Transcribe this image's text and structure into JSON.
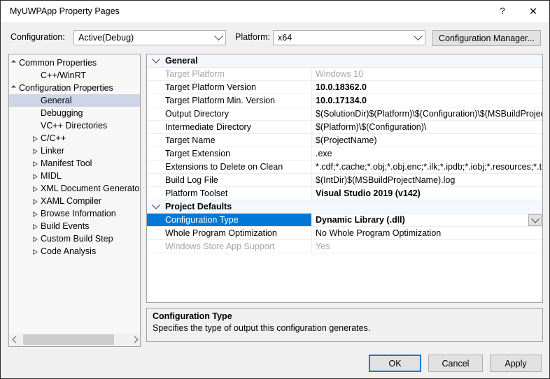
{
  "window": {
    "title": "MyUWPApp Property Pages",
    "help_icon": "help-icon",
    "help_glyph": "?",
    "close_icon": "close-icon",
    "close_glyph": "✕"
  },
  "configbar": {
    "configuration_label": "Configuration:",
    "configuration_value": "Active(Debug)",
    "platform_label": "Platform:",
    "platform_value": "x64",
    "configuration_manager_label": "Configuration Manager..."
  },
  "tree": {
    "selected": "General",
    "items": [
      {
        "label": "Common Properties",
        "indent": 14,
        "twisty": "expanded",
        "selected": false
      },
      {
        "label": "C++/WinRT",
        "indent": 45,
        "twisty": "none",
        "selected": false
      },
      {
        "label": "Configuration Properties",
        "indent": 14,
        "twisty": "expanded",
        "selected": false
      },
      {
        "label": "General",
        "indent": 45,
        "twisty": "none",
        "selected": true
      },
      {
        "label": "Debugging",
        "indent": 45,
        "twisty": "none",
        "selected": false
      },
      {
        "label": "VC++ Directories",
        "indent": 45,
        "twisty": "none",
        "selected": false
      },
      {
        "label": "C/C++",
        "indent": 45,
        "twisty": "collapsed",
        "selected": false
      },
      {
        "label": "Linker",
        "indent": 45,
        "twisty": "collapsed",
        "selected": false
      },
      {
        "label": "Manifest Tool",
        "indent": 45,
        "twisty": "collapsed",
        "selected": false
      },
      {
        "label": "MIDL",
        "indent": 45,
        "twisty": "collapsed",
        "selected": false
      },
      {
        "label": "XML Document Generator",
        "indent": 45,
        "twisty": "collapsed",
        "selected": false
      },
      {
        "label": "XAML Compiler",
        "indent": 45,
        "twisty": "collapsed",
        "selected": false
      },
      {
        "label": "Browse Information",
        "indent": 45,
        "twisty": "collapsed",
        "selected": false
      },
      {
        "label": "Build Events",
        "indent": 45,
        "twisty": "collapsed",
        "selected": false
      },
      {
        "label": "Custom Build Step",
        "indent": 45,
        "twisty": "collapsed",
        "selected": false
      },
      {
        "label": "Code Analysis",
        "indent": 45,
        "twisty": "collapsed",
        "selected": false
      }
    ],
    "hscroll": {
      "left_icon": "chevron-left-icon",
      "right_icon": "chevron-right-icon"
    }
  },
  "grid": {
    "rows": [
      {
        "kind": "category",
        "label": "General",
        "twisty": "expanded"
      },
      {
        "kind": "property",
        "name": "Target Platform",
        "value": "Windows 10",
        "disabled": true,
        "bold": false,
        "selected": false,
        "dropdown": false
      },
      {
        "kind": "property",
        "name": "Target Platform Version",
        "value": "10.0.18362.0",
        "disabled": false,
        "bold": true,
        "selected": false,
        "dropdown": false
      },
      {
        "kind": "property",
        "name": "Target Platform Min. Version",
        "value": "10.0.17134.0",
        "disabled": false,
        "bold": true,
        "selected": false,
        "dropdown": false
      },
      {
        "kind": "property",
        "name": "Output Directory",
        "value": "$(SolutionDir)$(Platform)\\$(Configuration)\\$(MSBuildProjectName)\\",
        "disabled": false,
        "bold": false,
        "selected": false,
        "dropdown": false
      },
      {
        "kind": "property",
        "name": "Intermediate Directory",
        "value": "$(Platform)\\$(Configuration)\\",
        "disabled": false,
        "bold": false,
        "selected": false,
        "dropdown": false
      },
      {
        "kind": "property",
        "name": "Target Name",
        "value": "$(ProjectName)",
        "disabled": false,
        "bold": false,
        "selected": false,
        "dropdown": false
      },
      {
        "kind": "property",
        "name": "Target Extension",
        "value": ".exe",
        "disabled": false,
        "bold": false,
        "selected": false,
        "dropdown": false
      },
      {
        "kind": "property",
        "name": "Extensions to Delete on Clean",
        "value": "*.cdf;*.cache;*.obj;*.obj.enc;*.ilk;*.ipdb;*.iobj;*.resources;*.tlb;*.tli;*.tlh;*.tmp",
        "disabled": false,
        "bold": false,
        "selected": false,
        "dropdown": false
      },
      {
        "kind": "property",
        "name": "Build Log File",
        "value": "$(IntDir)$(MSBuildProjectName).log",
        "disabled": false,
        "bold": false,
        "selected": false,
        "dropdown": false
      },
      {
        "kind": "property",
        "name": "Platform Toolset",
        "value": "Visual Studio 2019 (v142)",
        "disabled": false,
        "bold": true,
        "selected": false,
        "dropdown": false
      },
      {
        "kind": "category",
        "label": "Project Defaults",
        "twisty": "expanded"
      },
      {
        "kind": "property",
        "name": "Configuration Type",
        "value": "Dynamic Library (.dll)",
        "disabled": false,
        "bold": true,
        "selected": true,
        "dropdown": true
      },
      {
        "kind": "property",
        "name": "Whole Program Optimization",
        "value": "No Whole Program Optimization",
        "disabled": false,
        "bold": false,
        "selected": false,
        "dropdown": false
      },
      {
        "kind": "property",
        "name": "Windows Store App Support",
        "value": "Yes",
        "disabled": true,
        "bold": false,
        "selected": false,
        "dropdown": false
      }
    ]
  },
  "description": {
    "title": "Configuration Type",
    "body": "Specifies the type of output this configuration generates."
  },
  "footer": {
    "ok_label": "OK",
    "cancel_label": "Cancel",
    "apply_label": "Apply"
  },
  "colors": {
    "selection_blue": "#0078d7",
    "tree_selection": "#cdd5e6",
    "dialog_bg": "#f0f0f0",
    "category_bg": "#f4f7fb",
    "disabled_text": "#a6a6a6"
  }
}
